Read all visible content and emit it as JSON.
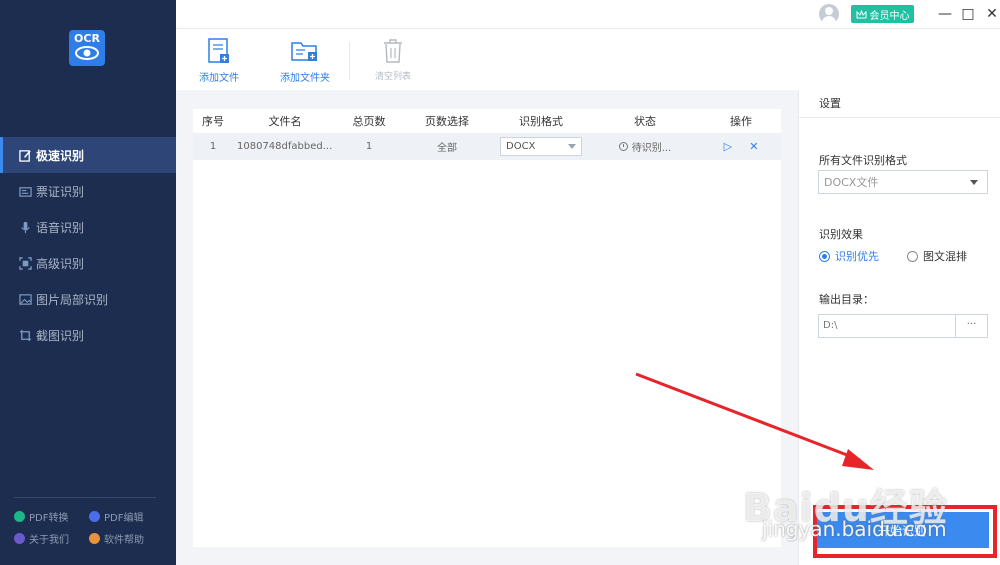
{
  "app": {
    "logo_text": "OCR"
  },
  "sidebar": {
    "items": [
      {
        "label": "极速识别",
        "icon": "edit-square-icon",
        "active": true
      },
      {
        "label": "票证识别",
        "icon": "id-card-icon"
      },
      {
        "label": "语音识别",
        "icon": "microphone-icon"
      },
      {
        "label": "高级识别",
        "icon": "scan-frame-icon"
      },
      {
        "label": "图片局部识别",
        "icon": "image-icon"
      },
      {
        "label": "截图识别",
        "icon": "crop-icon"
      }
    ],
    "bottom": [
      {
        "label": "PDF转换",
        "color": "#1fb58a"
      },
      {
        "label": "PDF编辑",
        "color": "#4c6de8"
      },
      {
        "label": "关于我们",
        "color": "#6a5acd"
      },
      {
        "label": "软件帮助",
        "color": "#e8923a"
      }
    ]
  },
  "titlebar": {
    "vip_label": "会员中心",
    "minimize": "—",
    "maximize": "□",
    "close": "✕"
  },
  "toolbar": {
    "add_file": "添加文件",
    "add_folder": "添加文件夹",
    "clear_list": "清空列表"
  },
  "table": {
    "headers": [
      "序号",
      "文件名",
      "总页数",
      "页数选择",
      "识别格式",
      "状态",
      "操作"
    ],
    "rows": [
      {
        "index": "1",
        "filename": "1080748dfabbed...",
        "pages": "1",
        "page_select": "全部",
        "format": "DOCX",
        "status": "待识别..."
      }
    ],
    "play_glyph": "▷",
    "delete_glyph": "✕"
  },
  "settings": {
    "title": "设置",
    "format_label": "所有文件识别格式",
    "format_value": "DOCX文件",
    "effect_label": "识别效果",
    "effect_options": [
      "识别优先",
      "图文混排"
    ],
    "effect_selected": "识别优先",
    "output_label": "输出目录：",
    "output_value": "D:\\",
    "browse_label": "···",
    "start_label": "开始识别"
  },
  "watermark": {
    "logo": "Baidu经验",
    "url": "jingyan.baidu.com"
  },
  "colors": {
    "sidebar": "#1c2d4f",
    "accent": "#2f7ee8",
    "vip": "#1fc1a1",
    "highlight": "#e8242b"
  }
}
